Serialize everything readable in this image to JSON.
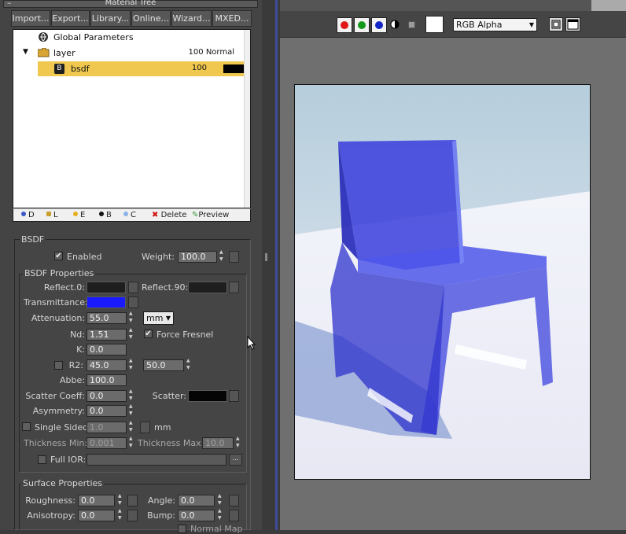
{
  "window": {
    "title": "Material Tree",
    "minimize": "–"
  },
  "toolbar": {
    "import": "Import...",
    "export": "Export...",
    "library": "Library...",
    "online": "Online...",
    "wizard": "Wizard...",
    "mxed": "MXED..."
  },
  "tree": {
    "global": "Global Parameters",
    "layer": {
      "label": "layer",
      "value": "100 Normal"
    },
    "bsdf": {
      "badge": "B",
      "label": "bsdf",
      "value": "100"
    }
  },
  "treebar": {
    "d": "D",
    "l": "L",
    "e": "E",
    "b": "B",
    "c": "C",
    "delete": "Delete",
    "preview": "Preview"
  },
  "bsdf": {
    "group": "BSDF",
    "enabled_label": "Enabled",
    "weight_label": "Weight:",
    "weight": "100.0",
    "props_group": "BSDF Properties",
    "reflect0": "Reflect.0:",
    "reflect90": "Reflect.90:",
    "transmittance": "Transmittance:",
    "attenuation_label": "Attenuation:",
    "attenuation": "55.0",
    "unit": "mm",
    "nd_label": "Nd:",
    "nd": "1.51",
    "force_fresnel": "Force Fresnel",
    "k_label": "K:",
    "k": "0.0",
    "r2_label": "R2:",
    "r2": "45.0",
    "r2b": "50.0",
    "abbe_label": "Abbe:",
    "abbe": "100.0",
    "scatter_coeff_label": "Scatter Coeff:",
    "scatter_coeff": "0.0",
    "scatter_label": "Scatter:",
    "asym_label": "Asymmetry:",
    "asym": "0.0",
    "single_sided_label": "Single Sided:",
    "single_sided": "1.0",
    "single_unit": "mm",
    "thick_min_label": "Thickness Min:",
    "thick_min": "0.001",
    "thick_max_label": "Thickness Max:",
    "thick_max": "10.0",
    "full_ior_label": "Full IOR:",
    "ellipsis": "..."
  },
  "surface": {
    "group": "Surface Properties",
    "rough_label": "Roughness:",
    "rough": "0.0",
    "angle_label": "Angle:",
    "angle": "0.0",
    "aniso_label": "Anisotropy:",
    "aniso": "0.0",
    "bump_label": "Bump:",
    "bump": "0.0",
    "normal_map": "Normal Map"
  },
  "render": {
    "channel": "RGB Alpha"
  },
  "colors": {
    "transmittance": "#1a1aff",
    "reflect": "#1e1e1e",
    "scatter": "#050505",
    "selected": "#f0c850"
  }
}
